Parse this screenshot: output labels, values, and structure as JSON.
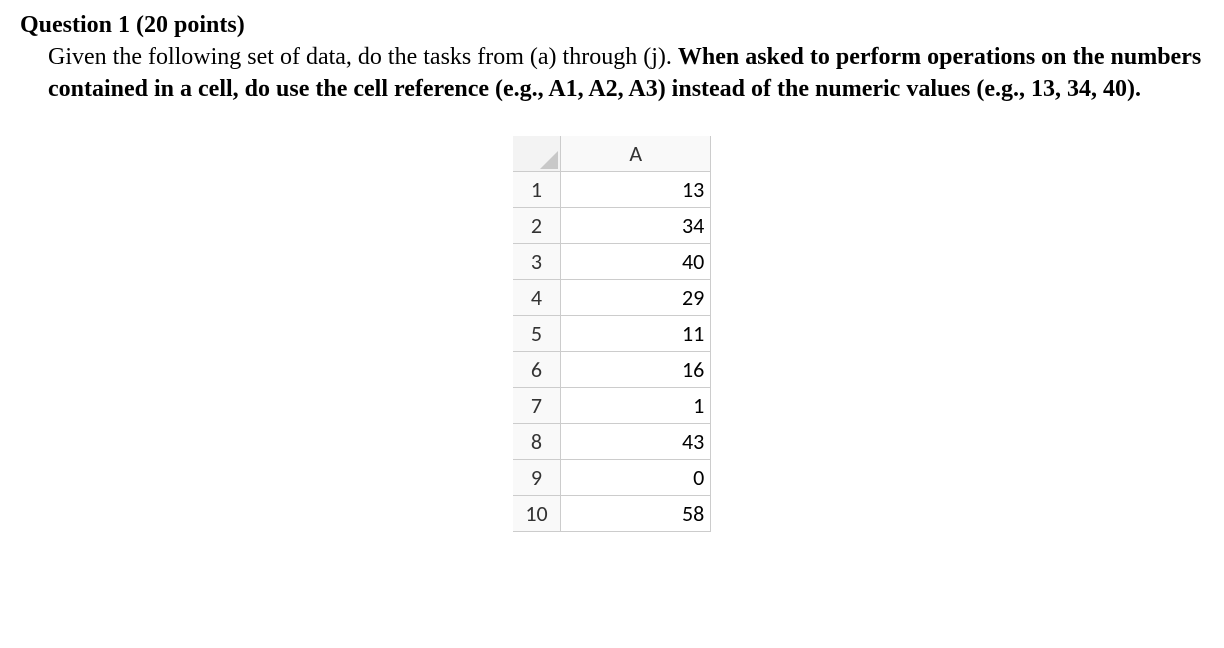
{
  "question": {
    "title": "Question 1 (20 points)",
    "intro": "Given the following set of data, do the tasks from (a) through (j). ",
    "bold_instruction": "When asked to perform operations on the numbers contained in a cell, do use the cell reference (e.g., A1, A2, A3) instead of the numeric values (e.g., 13, 34, 40)."
  },
  "spreadsheet": {
    "column_header": "A",
    "rows": [
      {
        "num": "1",
        "value": "13"
      },
      {
        "num": "2",
        "value": "34"
      },
      {
        "num": "3",
        "value": "40"
      },
      {
        "num": "4",
        "value": "29"
      },
      {
        "num": "5",
        "value": "11"
      },
      {
        "num": "6",
        "value": "16"
      },
      {
        "num": "7",
        "value": "1"
      },
      {
        "num": "8",
        "value": "43"
      },
      {
        "num": "9",
        "value": "0"
      },
      {
        "num": "10",
        "value": "58"
      }
    ]
  }
}
